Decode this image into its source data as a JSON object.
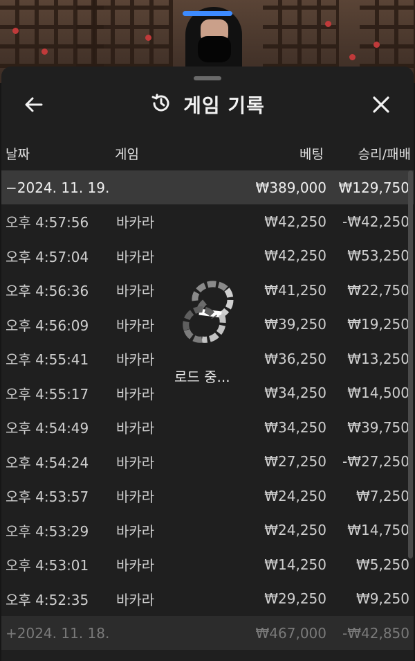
{
  "header": {
    "title": "게임 기록",
    "back_icon": "arrow-left-icon",
    "history_icon": "history-icon",
    "close_icon": "close-icon"
  },
  "columns": {
    "date": "날짜",
    "game": "게임",
    "bet": "베팅",
    "result": "승리/패배"
  },
  "day_groups": [
    {
      "label": "−2024. 11. 19.",
      "bet_total": "₩389,000",
      "result_total": "₩129,750",
      "rows": [
        {
          "time": "오후 4:57:56",
          "game": "바카라",
          "bet": "₩42,250",
          "result": "-₩42,250"
        },
        {
          "time": "오후 4:57:04",
          "game": "바카라",
          "bet": "₩42,250",
          "result": "₩53,250"
        },
        {
          "time": "오후 4:56:36",
          "game": "바카라",
          "bet": "₩41,250",
          "result": "₩22,750"
        },
        {
          "time": "오후 4:56:09",
          "game": "바카라",
          "bet": "₩39,250",
          "result": "₩19,250"
        },
        {
          "time": "오후 4:55:41",
          "game": "바카라",
          "bet": "₩36,250",
          "result": "₩13,250"
        },
        {
          "time": "오후 4:55:17",
          "game": "바카라",
          "bet": "₩34,250",
          "result": "₩14,500"
        },
        {
          "time": "오후 4:54:49",
          "game": "바카라",
          "bet": "₩34,250",
          "result": "₩39,750"
        },
        {
          "time": "오후 4:54:24",
          "game": "바카라",
          "bet": "₩27,250",
          "result": "-₩27,250"
        },
        {
          "time": "오후 4:53:57",
          "game": "바카라",
          "bet": "₩24,250",
          "result": "₩7,250"
        },
        {
          "time": "오후 4:53:29",
          "game": "바카라",
          "bet": "₩24,250",
          "result": "₩14,750"
        },
        {
          "time": "오후 4:53:01",
          "game": "바카라",
          "bet": "₩14,250",
          "result": "₩5,250"
        },
        {
          "time": "오후 4:52:35",
          "game": "바카라",
          "bet": "₩29,250",
          "result": "₩9,250"
        }
      ]
    },
    {
      "label": "+2024. 11. 18.",
      "bet_total": "₩467,000",
      "result_total": "-₩42,850",
      "rows": []
    }
  ],
  "loading": {
    "text": "로드 중...",
    "icon": "spinner-logo-icon"
  },
  "colors": {
    "sheet": "#1f1f1f",
    "day_row": "#3a3a3a",
    "accent": "#3d8bff"
  }
}
